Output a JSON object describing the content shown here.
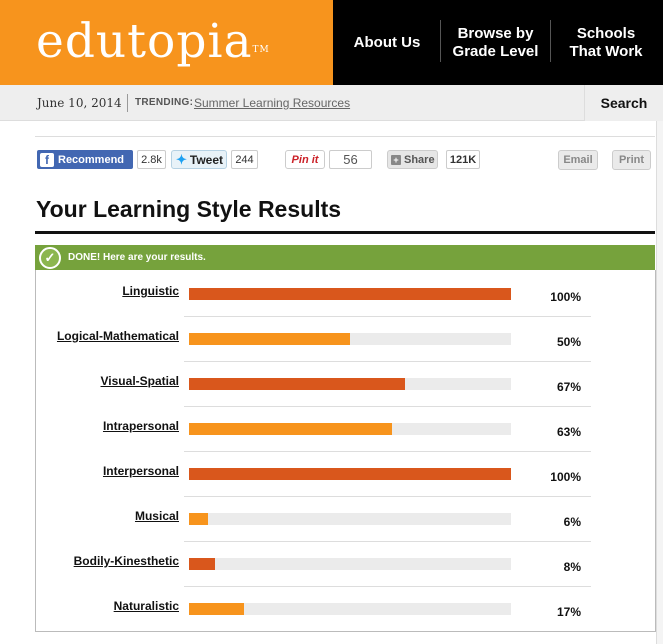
{
  "header": {
    "logo": "edutopia",
    "logo_tm": "TM",
    "nav": [
      {
        "label": "About Us"
      },
      {
        "label": "Browse by Grade Level"
      },
      {
        "label": "Schools That Work"
      }
    ],
    "colors": {
      "logo_bg": "#f7941d",
      "nav_bg": "#000000"
    }
  },
  "subbar": {
    "date": "June 10, 2014",
    "trending_label": "TRENDING:",
    "trending_link": "Summer Learning Resources",
    "search_label": "Search"
  },
  "share": {
    "recommend_label": "Recommend",
    "recommend_count": "2.8k",
    "tweet_label": "Tweet",
    "tweet_count": "244",
    "pin_label": "Pin it",
    "pin_count": "56",
    "share_label": "Share",
    "share_count": "121K",
    "email_label": "Email",
    "print_label": "Print"
  },
  "page": {
    "title": "Your Learning Style Results",
    "done_message": "DONE! Here are your results."
  },
  "results": [
    {
      "label": "Linguistic",
      "value": 100,
      "display": "100%",
      "color": "#d9571c"
    },
    {
      "label": "Logical-Mathematical",
      "value": 50,
      "display": "50%",
      "color": "#f7941d"
    },
    {
      "label": "Visual-Spatial",
      "value": 67,
      "display": "67%",
      "color": "#d9571c"
    },
    {
      "label": "Intrapersonal",
      "value": 63,
      "display": "63%",
      "color": "#f7941d"
    },
    {
      "label": "Interpersonal",
      "value": 100,
      "display": "100%",
      "color": "#d9571c"
    },
    {
      "label": "Musical",
      "value": 6,
      "display": "6%",
      "color": "#f7941d"
    },
    {
      "label": "Bodily-Kinesthetic",
      "value": 8,
      "display": "8%",
      "color": "#d9571c"
    },
    {
      "label": "Naturalistic",
      "value": 17,
      "display": "17%",
      "color": "#f7941d"
    }
  ]
}
